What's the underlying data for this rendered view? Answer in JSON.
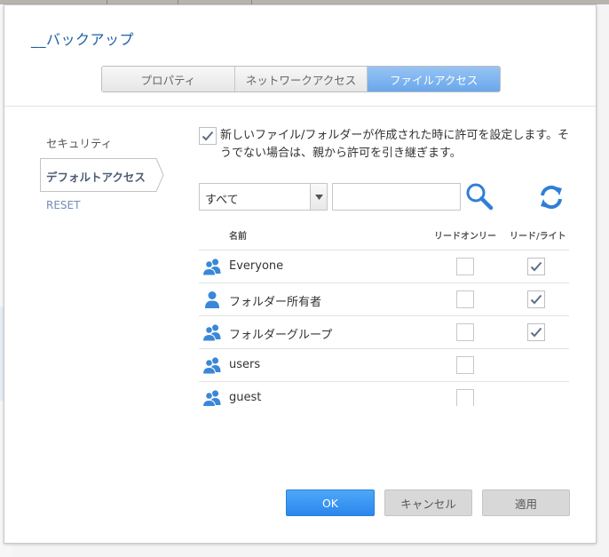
{
  "dialog": {
    "title": "__バックアップ"
  },
  "tabs": [
    {
      "label": "プロパティ"
    },
    {
      "label": "ネットワークアクセス"
    },
    {
      "label": "ファイルアクセス"
    }
  ],
  "nav": {
    "security": "セキュリティ",
    "default_access": "デフォルトアクセス",
    "reset": "RESET"
  },
  "inherit": {
    "checked": true,
    "text": "新しいファイル/フォルダーが作成された時に許可を設定します。そうでない場合は、親から許可を引き継ぎます。"
  },
  "filter": {
    "selected": "すべて",
    "search_value": ""
  },
  "table": {
    "columns": {
      "name": "名前",
      "read_only": "リードオンリー",
      "read_write": "リード/ライト"
    },
    "rows": [
      {
        "name": "Everyone",
        "icon": "group-icon",
        "read_only": false,
        "read_write": true
      },
      {
        "name": "フォルダー所有者",
        "icon": "user-icon",
        "read_only": false,
        "read_write": true
      },
      {
        "name": "フォルダーグループ",
        "icon": "group-icon",
        "read_only": false,
        "read_write": true
      },
      {
        "name": "users",
        "icon": "group-icon",
        "read_only": false,
        "read_write": null
      },
      {
        "name": "guest",
        "icon": "group-icon",
        "read_only": false,
        "read_write": null
      }
    ]
  },
  "buttons": {
    "ok": "OK",
    "cancel": "キャンセル",
    "apply": "適用"
  },
  "colors": {
    "accent": "#3b95f2",
    "title": "#1d5fa6",
    "icon": "#3a87d8"
  }
}
